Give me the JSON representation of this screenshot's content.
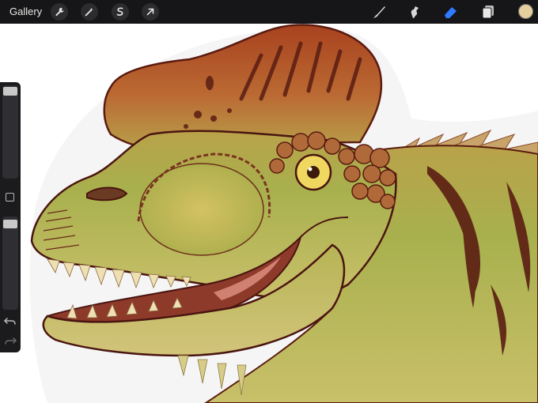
{
  "toolbar": {
    "gallery_label": "Gallery",
    "icons": [
      "wrench-icon",
      "magic-wand-icon",
      "selection-icon",
      "transform-arrow-icon",
      "brush-icon",
      "smudge-icon",
      "eraser-icon",
      "layers-icon"
    ],
    "eraser_active_color": "#2f7bff",
    "current_color": "#e6cf9f"
  },
  "sidebar": {
    "brush_size_level": 0.98,
    "opacity_level": 0.97,
    "icons": [
      "undo-icon",
      "redo-icon"
    ]
  },
  "canvas": {
    "subject": "dinosaur-head-illustration",
    "palette": {
      "crest": "#a54a22",
      "skin": "#a9b24f",
      "belly": "#cdbf66",
      "outline": "#5a1b10",
      "teeth": "#efe0b4",
      "mouth": "#8e3a2a",
      "eye": "#f0d860"
    }
  }
}
